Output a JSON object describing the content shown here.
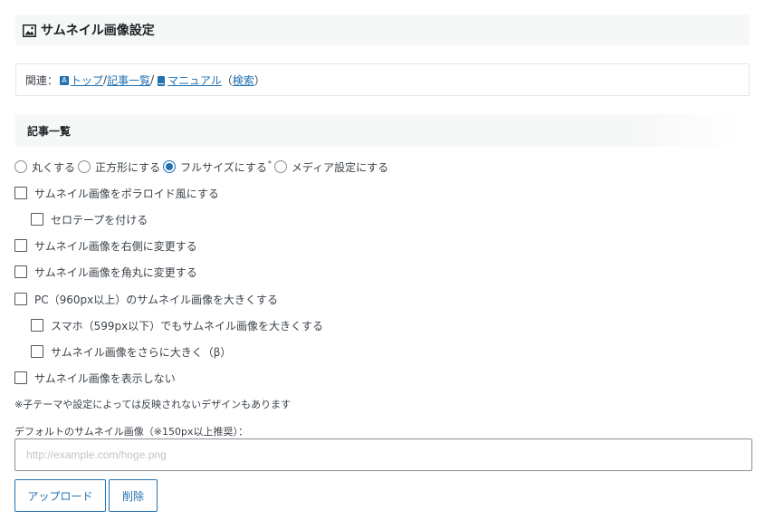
{
  "header": {
    "title": "サムネイル画像設定"
  },
  "related": {
    "prefix": "関連：",
    "link_top": "トップ",
    "separator1": " / ",
    "link_articles": "記事一覧",
    "separator2": " / ",
    "link_manual": "マニュアル",
    "open_paren": "（",
    "link_search": "検索",
    "close_paren": "）"
  },
  "section": {
    "title": "記事一覧"
  },
  "radio_options": [
    {
      "label": "丸くする",
      "checked": false
    },
    {
      "label": "正方形にする",
      "checked": false
    },
    {
      "label": "フルサイズにする",
      "checked": true,
      "star": "*"
    },
    {
      "label": "メディア設定にする",
      "checked": false
    }
  ],
  "checkboxes": [
    {
      "label": "サムネイル画像をポラロイド風にする",
      "checked": false
    },
    {
      "label": "セロテープを付ける",
      "checked": false
    },
    {
      "label": "サムネイル画像を右側に変更する",
      "checked": false
    },
    {
      "label": "サムネイル画像を角丸に変更する",
      "checked": false
    },
    {
      "label": "PC（960px以上）のサムネイル画像を大きくする",
      "checked": false
    },
    {
      "label": "スマホ（599px以下）でもサムネイル画像を大きくする",
      "checked": false
    },
    {
      "label": "サムネイル画像をさらに大きく（β）",
      "checked": false
    },
    {
      "label": "サムネイル画像を表示しない",
      "checked": false
    }
  ],
  "note": "※子テーマや設定によっては反映されないデザインもあります",
  "default_image": {
    "label": "デフォルトのサムネイル画像（※150px以上推奨）：",
    "value": "",
    "placeholder": "http://example.com/hoge.png"
  },
  "buttons": {
    "upload": "アップロード",
    "delete": "削除"
  },
  "colors": {
    "accent": "#2271b1",
    "header_bg": "#f6f7f7"
  }
}
